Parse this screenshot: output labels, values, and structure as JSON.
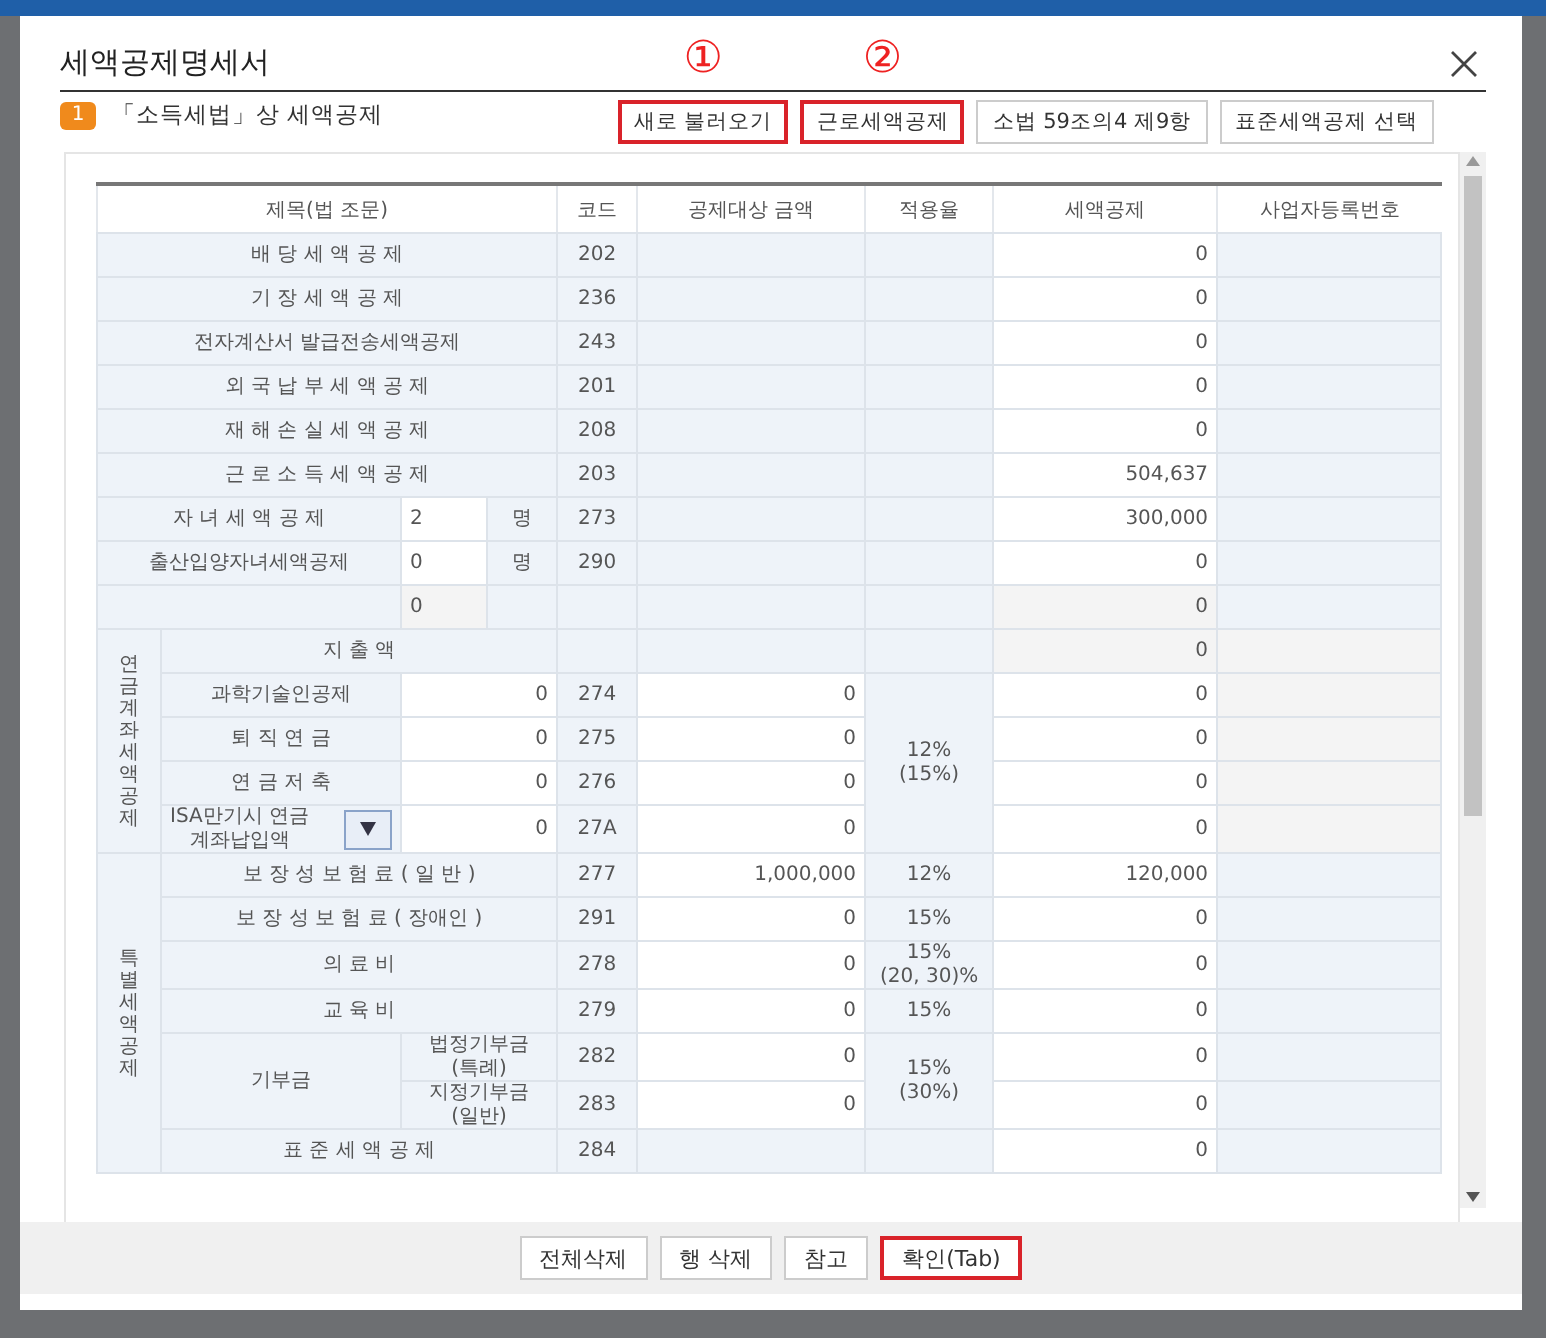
{
  "dialog": {
    "title": "세액공제명세서"
  },
  "section": {
    "number": "1",
    "title": "「소득세법」상 세액공제"
  },
  "toolbar": [
    {
      "label": "새로 불러오기",
      "marker": "①",
      "highlighted": true
    },
    {
      "label": "근로세액공제",
      "marker": "②",
      "highlighted": true
    },
    {
      "label": "소법 59조의4 제9항",
      "highlighted": false
    },
    {
      "label": "표준세액공제 선택",
      "highlighted": false
    }
  ],
  "table": {
    "columns": [
      "제목(법 조문)",
      "코드",
      "공제대상 금액",
      "적용율",
      "세액공제",
      "사업자등록번호"
    ],
    "rows": [
      {
        "kind": "simple",
        "title": "배 당 세 액 공 제",
        "code": "202",
        "credit": "0"
      },
      {
        "kind": "simple",
        "title": "기 장 세 액 공 제",
        "code": "236",
        "credit": "0"
      },
      {
        "kind": "simple",
        "title": "전자계산서 발급전송세액공제",
        "code": "243",
        "credit": "0"
      },
      {
        "kind": "simple",
        "title": "외 국 납 부 세 액 공 제",
        "code": "201",
        "credit": "0"
      },
      {
        "kind": "simple",
        "title": "재 해 손 실 세 액 공 제",
        "code": "208",
        "credit": "0"
      },
      {
        "kind": "simple",
        "title": "근 로 소 득 세 액 공 제",
        "code": "203",
        "credit": "504,637"
      },
      {
        "kind": "count",
        "title": "자 녀 세 액 공 제",
        "count": "2",
        "unit": "명",
        "code": "273",
        "credit": "300,000"
      },
      {
        "kind": "count",
        "title": "출산입양자녀세액공제",
        "count": "0",
        "unit": "명",
        "code": "290",
        "credit": "0"
      },
      {
        "kind": "blank_count",
        "count": "0",
        "credit": "0"
      },
      {
        "kind": "group",
        "title": "연금계좌세액공제",
        "rows": [
          {
            "kind": "spend_header",
            "title": "지 출 액",
            "credit": "0"
          },
          {
            "kind": "rate_block",
            "rate": "12%\n(15%)",
            "rows": [
              {
                "kind": "pension",
                "title": "과학기술인공제",
                "spend": "0",
                "code": "274",
                "amount": "0",
                "credit": "0"
              },
              {
                "kind": "pension",
                "title": "퇴 직 연 금",
                "spend": "0",
                "code": "275",
                "amount": "0",
                "credit": "0"
              },
              {
                "kind": "pension",
                "title": "연 금 저 축",
                "spend": "0",
                "code": "276",
                "amount": "0",
                "credit": "0"
              },
              {
                "kind": "pension_dropdown",
                "title": "ISA만기시 연금\n계좌납입액",
                "spend": "0",
                "code": "27A",
                "amount": "0",
                "credit": "0"
              }
            ]
          }
        ]
      },
      {
        "kind": "group",
        "title": "특별세액공제",
        "rows": [
          {
            "kind": "rated",
            "title": "보 장 성 보 험 료 ( 일 반 )",
            "code": "277",
            "amount": "1,000,000",
            "rate": "12%",
            "credit": "120,000"
          },
          {
            "kind": "rated",
            "title": "보 장 성 보 험 료 ( 장애인 )",
            "code": "291",
            "amount": "0",
            "rate": "15%",
            "credit": "0"
          },
          {
            "kind": "rated",
            "title": "의 료 비",
            "code": "278",
            "amount": "0",
            "rate": "15%\n(20, 30)%",
            "credit": "0"
          },
          {
            "kind": "rated",
            "title": "교 육 비",
            "code": "279",
            "amount": "0",
            "rate": "15%",
            "credit": "0"
          },
          {
            "kind": "rate_block",
            "title": "기부금",
            "rate": "15%\n(30%)",
            "rows": [
              {
                "kind": "sub",
                "title": "법정기부금\n(특례)",
                "code": "282",
                "amount": "0",
                "credit": "0"
              },
              {
                "kind": "sub",
                "title": "지정기부금\n(일반)",
                "code": "283",
                "amount": "0",
                "credit": "0"
              }
            ]
          },
          {
            "kind": "simple",
            "title": "표 준 세 액 공 제",
            "code": "284",
            "credit": "0"
          }
        ]
      }
    ]
  },
  "footer_buttons": [
    {
      "label": "전체삭제",
      "highlighted": false
    },
    {
      "label": "행 삭제",
      "highlighted": false
    },
    {
      "label": "참고",
      "highlighted": false
    },
    {
      "label": "확인(Tab)",
      "highlighted": true
    }
  ]
}
